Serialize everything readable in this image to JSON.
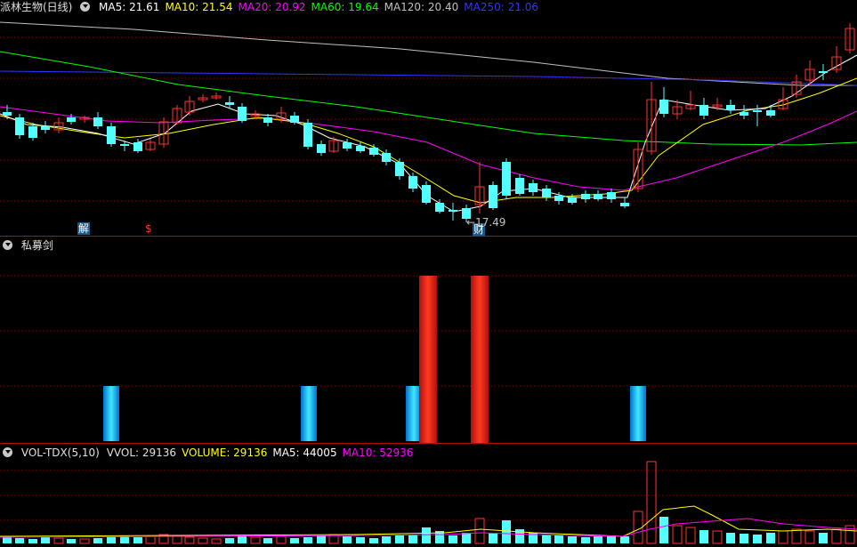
{
  "price_panel": {
    "title": "派林生物(日线)",
    "ma_labels": [
      {
        "text": "MA5: 21.61",
        "color": "#ffffff"
      },
      {
        "text": "MA10: 21.54",
        "color": "#ffff00"
      },
      {
        "text": "MA20: 20.92",
        "color": "#ff00ff"
      },
      {
        "text": "MA60: 19.64",
        "color": "#00ff00"
      },
      {
        "text": "MA120: 20.40",
        "color": "#c0c0c0"
      },
      {
        "text": "MA250: 21.06",
        "color": "#3333ff"
      }
    ],
    "low_label": "17.49",
    "tag_jie": "解",
    "tag_dollar": "$",
    "tag_cai": "财"
  },
  "indicator_panel": {
    "title": "私募剑"
  },
  "volume_panel": {
    "title": "VOL-TDX(5,10)",
    "labels": [
      {
        "text": "VVOL: 29136",
        "color": "#e0e0e0"
      },
      {
        "text": "VOLUME: 29136",
        "color": "#ffff00"
      },
      {
        "text": "MA5: 44005",
        "color": "#ffffff"
      },
      {
        "text": "MA10: 52936",
        "color": "#ff00ff"
      }
    ]
  },
  "colors": {
    "up": "#ff3232",
    "down": "#54ffff",
    "grid": "#8b0000",
    "separator": "#b01010"
  },
  "chart_data": [
    {
      "type": "candlestick",
      "series": [
        {
          "name": "MA5",
          "values": [
            21.61
          ]
        },
        {
          "name": "MA10",
          "values": [
            21.54
          ]
        },
        {
          "name": "MA20",
          "values": [
            20.92
          ]
        },
        {
          "name": "MA60",
          "values": [
            19.64
          ]
        },
        {
          "name": "MA120",
          "values": [
            20.4
          ]
        },
        {
          "name": "MA250",
          "values": [
            21.06
          ]
        }
      ],
      "annotations": [
        "17.49"
      ]
    },
    {
      "type": "bar",
      "series": [
        {
          "name": "VVOL",
          "values": [
            29136
          ]
        },
        {
          "name": "VOLUME",
          "values": [
            29136
          ]
        },
        {
          "name": "MA5",
          "values": [
            44005
          ]
        },
        {
          "name": "MA10",
          "values": [
            52936
          ]
        }
      ]
    }
  ]
}
